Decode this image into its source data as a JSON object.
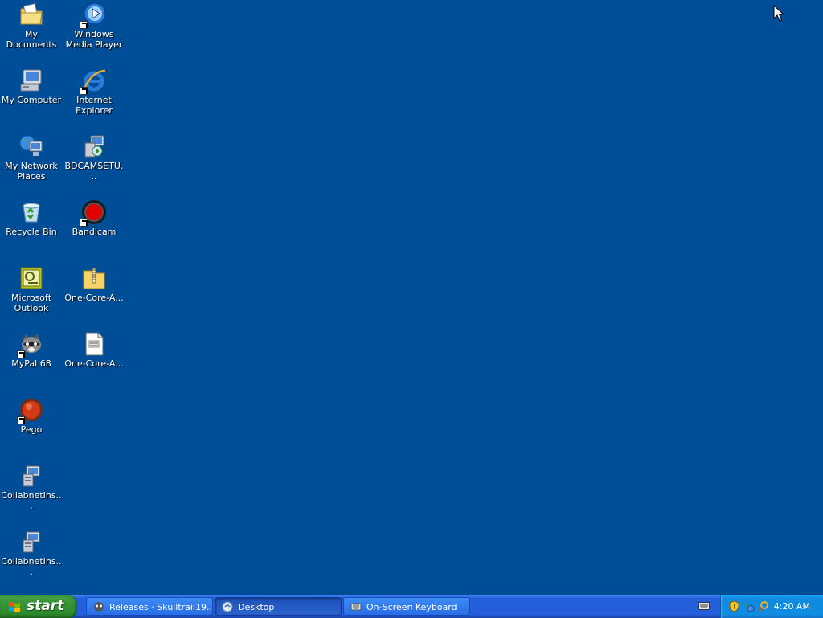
{
  "desktop": {
    "background_color": "#004e98",
    "icons": [
      {
        "label": "My Documents",
        "icon": "my-documents-icon"
      },
      {
        "label": "Windows Media Player",
        "icon": "windows-media-player-icon"
      },
      {
        "label": "My Computer",
        "icon": "my-computer-icon"
      },
      {
        "label": "Internet Explorer",
        "icon": "internet-explorer-icon"
      },
      {
        "label": "My Network Places",
        "icon": "network-places-icon"
      },
      {
        "label": "BDCAMSETU...",
        "icon": "setup-installer-icon"
      },
      {
        "label": "Recycle Bin",
        "icon": "recycle-bin-icon"
      },
      {
        "label": "Bandicam",
        "icon": "bandicam-icon"
      },
      {
        "label": "Microsoft Outlook",
        "icon": "outlook-icon"
      },
      {
        "label": "One-Core-A...",
        "icon": "zip-folder-icon"
      },
      {
        "label": "MyPal 68",
        "icon": "mypal-icon"
      },
      {
        "label": "One-Core-A...",
        "icon": "document-file-icon"
      },
      {
        "label": "Pego",
        "icon": "pego-icon"
      },
      {
        "label": "CollabnetIns...",
        "icon": "installer-icon"
      },
      {
        "label": "CollabnetIns...",
        "icon": "installer-icon"
      }
    ]
  },
  "taskbar": {
    "start_label": "start",
    "tasks": [
      {
        "label": "Releases · Skulltrail19...",
        "icon": "browser-icon"
      },
      {
        "label": "Desktop",
        "icon": "desktop-icon",
        "active": true
      },
      {
        "label": "On-Screen Keyboard",
        "icon": "keyboard-icon"
      }
    ],
    "tray_icons": [
      "security-shield-icon",
      "network-icon",
      "search-icon"
    ],
    "clock": "4:20 AM"
  }
}
